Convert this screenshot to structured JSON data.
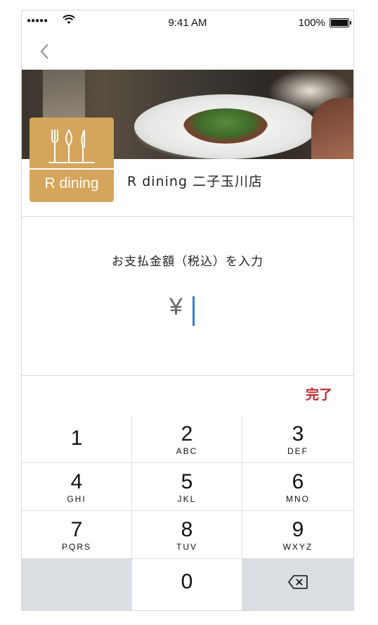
{
  "status_bar": {
    "signal": "●●●●●",
    "time": "9:41 AM",
    "battery_text": "100%"
  },
  "store": {
    "logo_text": "R dining",
    "name": "R dining 二子玉川店"
  },
  "payment": {
    "prompt": "お支払金額（税込）を入力",
    "currency_symbol": "¥",
    "amount": ""
  },
  "keyboard": {
    "done_label": "完了",
    "keys": [
      {
        "digit": "1",
        "letters": ""
      },
      {
        "digit": "2",
        "letters": "ABC"
      },
      {
        "digit": "3",
        "letters": "DEF"
      },
      {
        "digit": "4",
        "letters": "GHI"
      },
      {
        "digit": "5",
        "letters": "JKL"
      },
      {
        "digit": "6",
        "letters": "MNO"
      },
      {
        "digit": "7",
        "letters": "PQRS"
      },
      {
        "digit": "8",
        "letters": "TUV"
      },
      {
        "digit": "9",
        "letters": "WXYZ"
      },
      {
        "digit": "0",
        "letters": ""
      }
    ],
    "delete_icon": "backspace-icon"
  },
  "colors": {
    "accent": "#c1272d",
    "logo_bg": "#d4a55a",
    "caret": "#2f7ed8"
  }
}
